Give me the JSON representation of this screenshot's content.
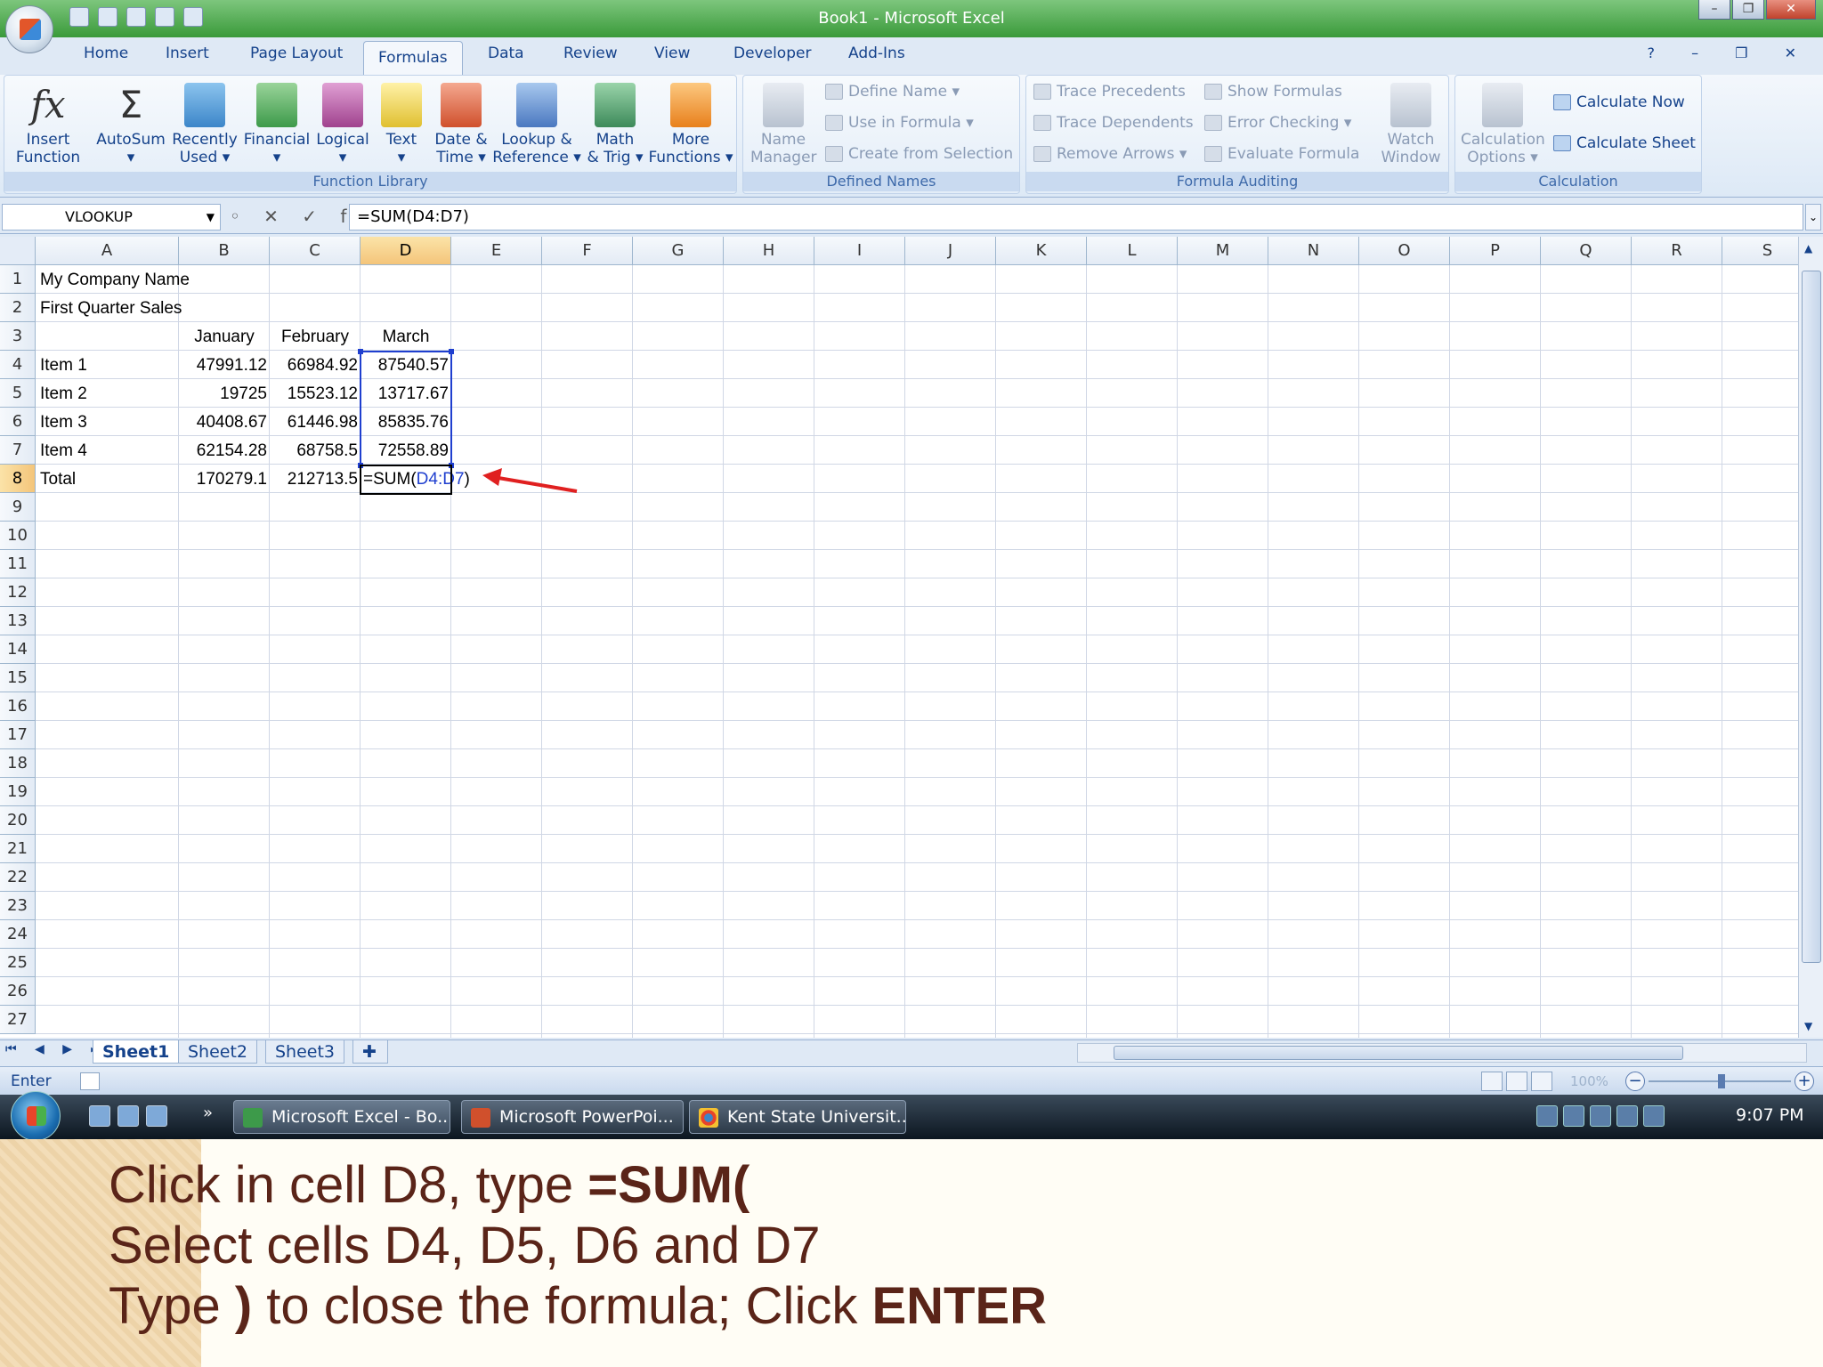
{
  "window": {
    "title": "Book1 - Microsoft Excel",
    "minimize": "–",
    "maximize": "❐",
    "close": "✕"
  },
  "tabs": [
    "Home",
    "Insert",
    "Page Layout",
    "Formulas",
    "Data",
    "Review",
    "View",
    "Developer",
    "Add-Ins"
  ],
  "active_tab": "Formulas",
  "help_controls": "? – ❐ ✕",
  "ribbon": {
    "function_library": {
      "label": "Function Library",
      "insert_function": [
        "Insert",
        "Function"
      ],
      "autosum": [
        "AutoSum",
        "▾"
      ],
      "recently_used": [
        "Recently",
        "Used ▾"
      ],
      "financial": [
        "Financial",
        "▾"
      ],
      "logical": [
        "Logical",
        "▾"
      ],
      "text": [
        "Text",
        "▾"
      ],
      "date_time": [
        "Date &",
        "Time ▾"
      ],
      "lookup_reference": [
        "Lookup &",
        "Reference ▾"
      ],
      "math_trig": [
        "Math",
        "& Trig ▾"
      ],
      "more_functions": [
        "More",
        "Functions ▾"
      ]
    },
    "defined_names": {
      "label": "Defined Names",
      "name_manager": [
        "Name",
        "Manager"
      ],
      "define_name": "Define Name ▾",
      "use_in_formula": "Use in Formula ▾",
      "create_from_selection": "Create from Selection"
    },
    "formula_auditing": {
      "label": "Formula Auditing",
      "trace_precedents": "Trace Precedents",
      "trace_dependents": "Trace Dependents",
      "remove_arrows": "Remove Arrows ▾",
      "show_formulas": "Show Formulas",
      "error_checking": "Error Checking ▾",
      "evaluate_formula": "Evaluate Formula",
      "watch_window": [
        "Watch",
        "Window"
      ]
    },
    "calculation": {
      "label": "Calculation",
      "calculation_options": [
        "Calculation",
        "Options ▾"
      ],
      "calculate_now": "Calculate Now",
      "calculate_sheet": "Calculate Sheet"
    }
  },
  "formula_bar": {
    "name_box": "VLOOKUP",
    "icons": "◦ ✕ ✓ fx",
    "formula": "=SUM(D4:D7)"
  },
  "columns": [
    "A",
    "B",
    "C",
    "D",
    "E",
    "F",
    "G",
    "H",
    "I",
    "J",
    "K",
    "L",
    "M",
    "N",
    "O",
    "P",
    "Q",
    "R",
    "S"
  ],
  "selected_column": "D",
  "rows": [
    "1",
    "2",
    "3",
    "4",
    "5",
    "6",
    "7",
    "8",
    "9",
    "10",
    "11",
    "12",
    "13",
    "14",
    "15",
    "16",
    "17",
    "18",
    "19",
    "20",
    "21",
    "22",
    "23",
    "24",
    "25",
    "26",
    "27"
  ],
  "selected_row": "8",
  "cells": {
    "A1": "My Company Name",
    "A2": "First Quarter Sales",
    "B3": "January",
    "C3": "February",
    "D3": "March",
    "A4": "Item 1",
    "B4": "47991.12",
    "C4": "66984.92",
    "D4": "87540.57",
    "A5": "Item 2",
    "B5": "19725",
    "C5": "15523.12",
    "D5": "13717.67",
    "A6": "Item 3",
    "B6": "40408.67",
    "C6": "61446.98",
    "D6": "85835.76",
    "A7": "Item 4",
    "B7": "62154.28",
    "C7": "68758.5",
    "D7": "72558.89",
    "A8": "Total",
    "B8": "170279.1",
    "C8": "212713.5",
    "D8_prefix": "=SUM(",
    "D8_ref": "D4:D7",
    "D8_suffix": ")"
  },
  "colors": {
    "range_ref": "#1f3fcf",
    "annotation_arrow": "#e02020",
    "instruction_text": "#5a2418"
  },
  "sheet_nav": "⏮ ◀ ▶ ⏭",
  "sheets": [
    "Sheet1",
    "Sheet2",
    "Sheet3"
  ],
  "active_sheet": "Sheet1",
  "status": {
    "mode": "Enter",
    "zoom": "100%"
  },
  "taskbar": {
    "more": "»",
    "tasks": [
      "Microsoft Excel - Bo...",
      "Microsoft PowerPoi...",
      "Kent State Universit..."
    ],
    "clock": "9:07 PM"
  },
  "instructions": {
    "line1_prefix": "Click in cell D8, type ",
    "line1_bold": "=SUM(",
    "line2": "Select cells D4, D5, D6 and D7",
    "line3_prefix": "Type ",
    "line3_bold1": ")",
    "line3_mid": " to close the formula; Click ",
    "line3_bold2": "ENTER"
  }
}
